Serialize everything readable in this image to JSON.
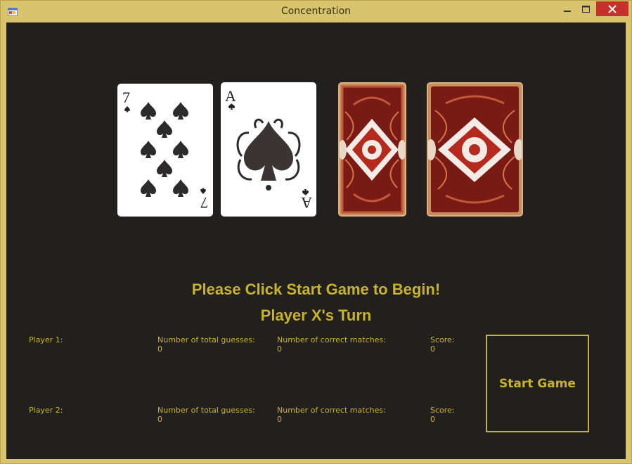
{
  "window": {
    "title": "Concentration"
  },
  "cards": [
    {
      "state": "face-up",
      "rank": "7",
      "suit": "spades"
    },
    {
      "state": "face-up",
      "rank": "A",
      "suit": "spades"
    },
    {
      "state": "face-down"
    },
    {
      "state": "face-down"
    }
  ],
  "messages": {
    "instruction": "Please Click Start Game to Begin!",
    "turn": "Player X's Turn"
  },
  "players": [
    {
      "label": "Player 1:",
      "guesses_label": "Number of total guesses:",
      "guesses_value": "0",
      "matches_label": "Number of correct matches:",
      "matches_value": "0",
      "score_label": "Score:",
      "score_value": "0"
    },
    {
      "label": "Player 2:",
      "guesses_label": "Number of total guesses:",
      "guesses_value": "0",
      "matches_label": "Number of correct matches:",
      "matches_value": "0",
      "score_label": "Score:",
      "score_value": "0"
    }
  ],
  "start_button": {
    "label": "Start Game"
  },
  "colors": {
    "accent": "#c8b32d",
    "background": "#221f1f",
    "window_frame": "#d8c46b",
    "close_button": "#c7312b"
  }
}
